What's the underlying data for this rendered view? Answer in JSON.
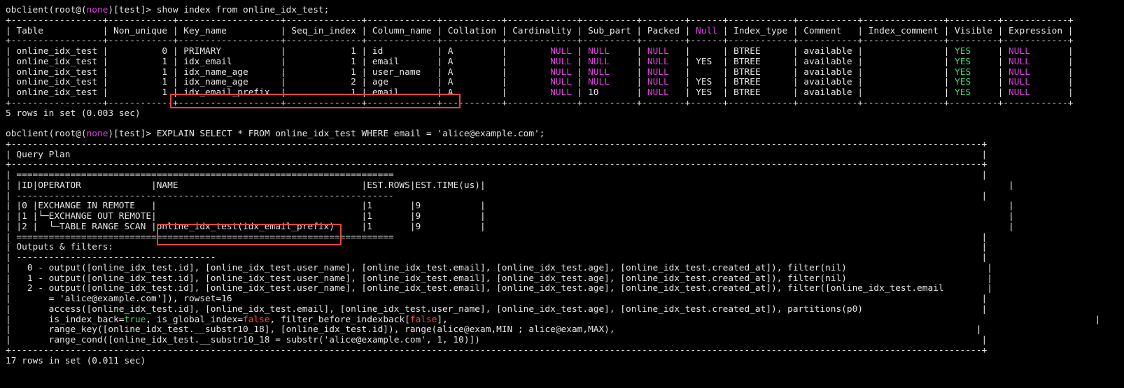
{
  "prompt_user": "root@",
  "prompt_none": "none",
  "prompt_db": ")[test]> ",
  "cmd1": "show index from online_idx_test;",
  "cmd2": "EXPLAIN SELECT * FROM online_idx_test WHERE email = 'alice@example.com';",
  "null_text": "NULL",
  "true_text": "true",
  "false_text": "false",
  "yes_text": "YES",
  "index_border": "+-----------------+------------+-------------------+--------------+-------------+-----------+-------------+----------+--------+------+------------+-----------+---------------+---------+------------+",
  "index_header": {
    "c1": "| Table           | Non_unique | Key_name          | Seq_in_index | Column_name | Collation | Cardinality | Sub_part | Packed | ",
    "null": "Null",
    "c2": " | Index_type | Comment   | Index_comment | Visible | Expression |"
  },
  "index_rows": [
    {
      "name": "online_idx_test",
      "nonuniq": "0",
      "key": "PRIMARY",
      "seq": "1",
      "col": "id",
      "coll": "A",
      "sub": "NULL",
      "nul": "",
      "type": "BTREE",
      "comment": "available"
    },
    {
      "name": "online_idx_test",
      "nonuniq": "1",
      "key": "idx_email",
      "seq": "1",
      "col": "email",
      "coll": "A",
      "sub": "NULL",
      "nul": "YES",
      "type": "BTREE",
      "comment": "available"
    },
    {
      "name": "online_idx_test",
      "nonuniq": "1",
      "key": "idx_name_age",
      "seq": "1",
      "col": "user_name",
      "coll": "A",
      "sub": "NULL",
      "nul": "",
      "type": "BTREE",
      "comment": "available"
    },
    {
      "name": "online_idx_test",
      "nonuniq": "1",
      "key": "idx_name_age",
      "seq": "2",
      "col": "age",
      "coll": "A",
      "sub": "NULL",
      "nul": "YES",
      "type": "BTREE",
      "comment": "available"
    },
    {
      "name": "online_idx_test",
      "nonuniq": "1",
      "key": "idx_email_prefix",
      "seq": "1",
      "col": "email",
      "coll": "A",
      "sub": "10",
      "nul": "YES",
      "type": "BTREE",
      "comment": "available"
    }
  ],
  "index_summary": "5 rows in set (0.003 sec)",
  "plan_border": "+------------------------------------------------------------------------------------------------------------------------------------------------------------------------------------+",
  "plan_title": "| Query Plan                                                                                                                                                                         |",
  "plan_lines": [
    "| ======================================================================                                                                                                             |",
    "| |ID|OPERATOR             |NAME                                  |EST.ROWS|EST.TIME(us)|                                                                                                 |",
    "| ----------------------------------------------------------------------                                                                                                             |",
    "| |0 |EXCHANGE IN REMOTE   |                                      |1       |9           |                                                                                                 |",
    "| |1 |└─EXCHANGE OUT REMOTE|                                      |1       |9           |                                                                                                 |",
    "| |2 |  └─TABLE RANGE SCAN |online_idx_test(idx_email_prefix)     |1       |9           |                                                                                                 |",
    "| ======================================================================                                                                                                             |",
    "| Outputs & filters:                                                                                                                                                                 |",
    "| -------------------------------------                                                                                                                                              |",
    "|   0 - output([online_idx_test.id], [online_idx_test.user_name], [online_idx_test.email], [online_idx_test.age], [online_idx_test.created_at]), filter(nil)                          |",
    "|   1 - output([online_idx_test.id], [online_idx_test.user_name], [online_idx_test.email], [online_idx_test.age], [online_idx_test.created_at]), filter(nil)                          |",
    "|   2 - output([online_idx_test.id], [online_idx_test.user_name], [online_idx_test.email], [online_idx_test.age], [online_idx_test.created_at]), filter([online_idx_test.email        |",
    "|       = 'alice@example.com']), rowset=16                                                                                                                                           |",
    "|       access([online_idx_test.id], [online_idx_test.email], [online_idx_test.user_name], [online_idx_test.age], [online_idx_test.created_at]), partitions(p0)                      |"
  ],
  "flags_line": {
    "a": "|       is_index_back=",
    "b": ", is_global_index=",
    "c": ", filter_before_indexback[",
    "d": "],                                                                                                                        |"
  },
  "plan_tail": [
    "|       range_key([online_idx_test.__substr10_18], [online_idx_test.id]), range(alice@exam,MIN ; alice@exam,MAX),                                                                   |",
    "|       range_cond([online_idx_test.__substr10_18 = substr('alice@example.com', 1, 10)])                                                                                             |"
  ],
  "plan_summary": "17 rows in set (0.011 sec)"
}
